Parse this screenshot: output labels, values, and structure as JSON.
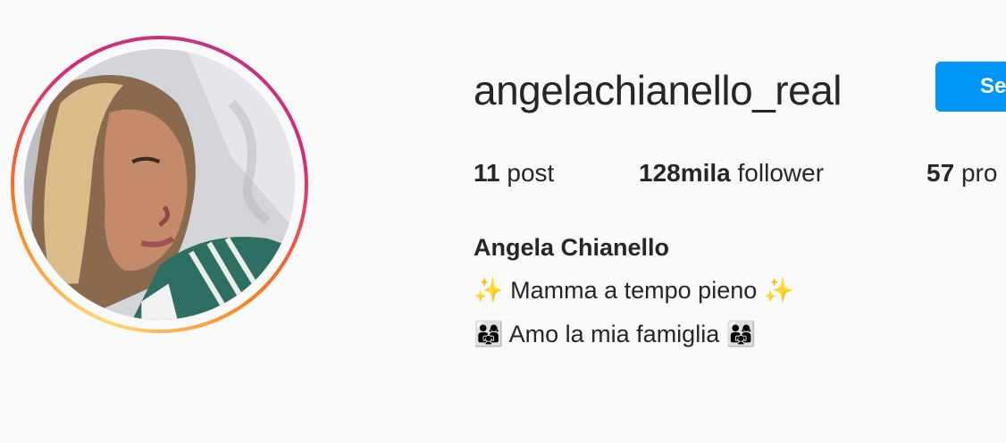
{
  "profile": {
    "username": "angelachianello_real",
    "follow_label": "Se",
    "full_name": "Angela Chianello",
    "bio": [
      "✨ Mamma a tempo pieno ✨",
      "👨‍👩‍👧 Amo la mia famiglia 👨‍👩‍👧"
    ]
  },
  "stats": {
    "posts": {
      "count": "11",
      "label": "post"
    },
    "followers": {
      "count": "128mila",
      "label": "follower"
    },
    "following": {
      "count": "57",
      "label": "pro"
    }
  },
  "colors": {
    "accent": "#0095f6",
    "text": "#262626",
    "background": "#fafafa"
  }
}
